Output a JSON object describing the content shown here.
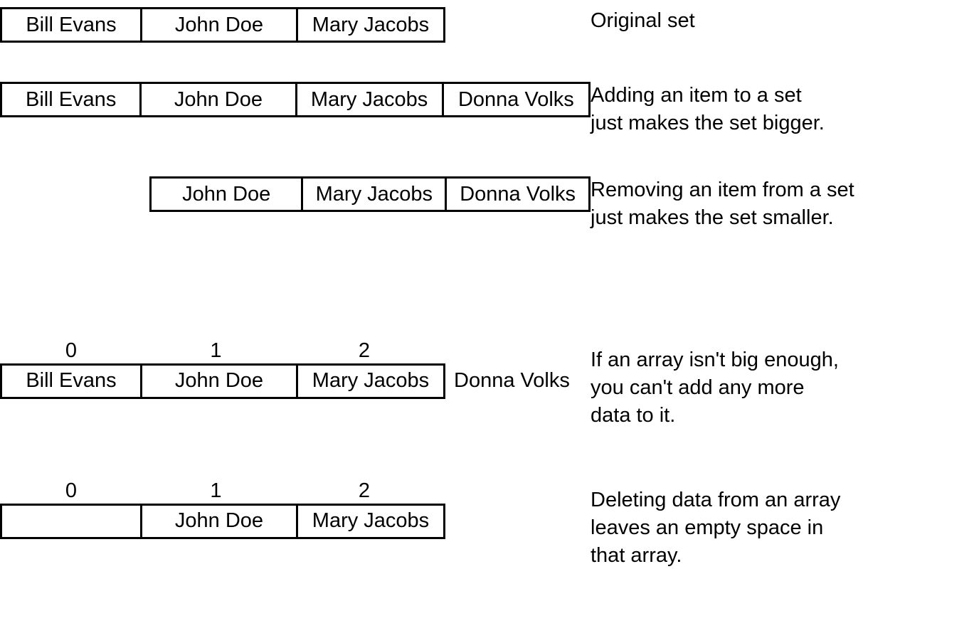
{
  "rows": [
    {
      "cells": [
        "Bill Evans",
        "John Doe",
        "Mary Jacobs"
      ],
      "caption": "Original set"
    },
    {
      "cells": [
        "Bill Evans",
        "John Doe",
        "Mary Jacobs",
        "Donna Volks"
      ],
      "caption": "Adding an item to a set\njust makes the set bigger."
    },
    {
      "cells": [
        "John Doe",
        "Mary Jacobs",
        "Donna Volks"
      ],
      "caption": "Removing an item from a set\njust makes the set smaller."
    },
    {
      "indices": [
        "0",
        "1",
        "2"
      ],
      "cells": [
        "Bill Evans",
        "John Doe",
        "Mary Jacobs"
      ],
      "outside": "Donna Volks",
      "caption": "If an array isn't big enough,\nyou can't add any more\ndata to it."
    },
    {
      "indices": [
        "0",
        "1",
        "2"
      ],
      "cells": [
        "",
        "John Doe",
        "Mary Jacobs"
      ],
      "caption": "Deleting data from an array\nleaves an empty space in\nthat array."
    }
  ]
}
